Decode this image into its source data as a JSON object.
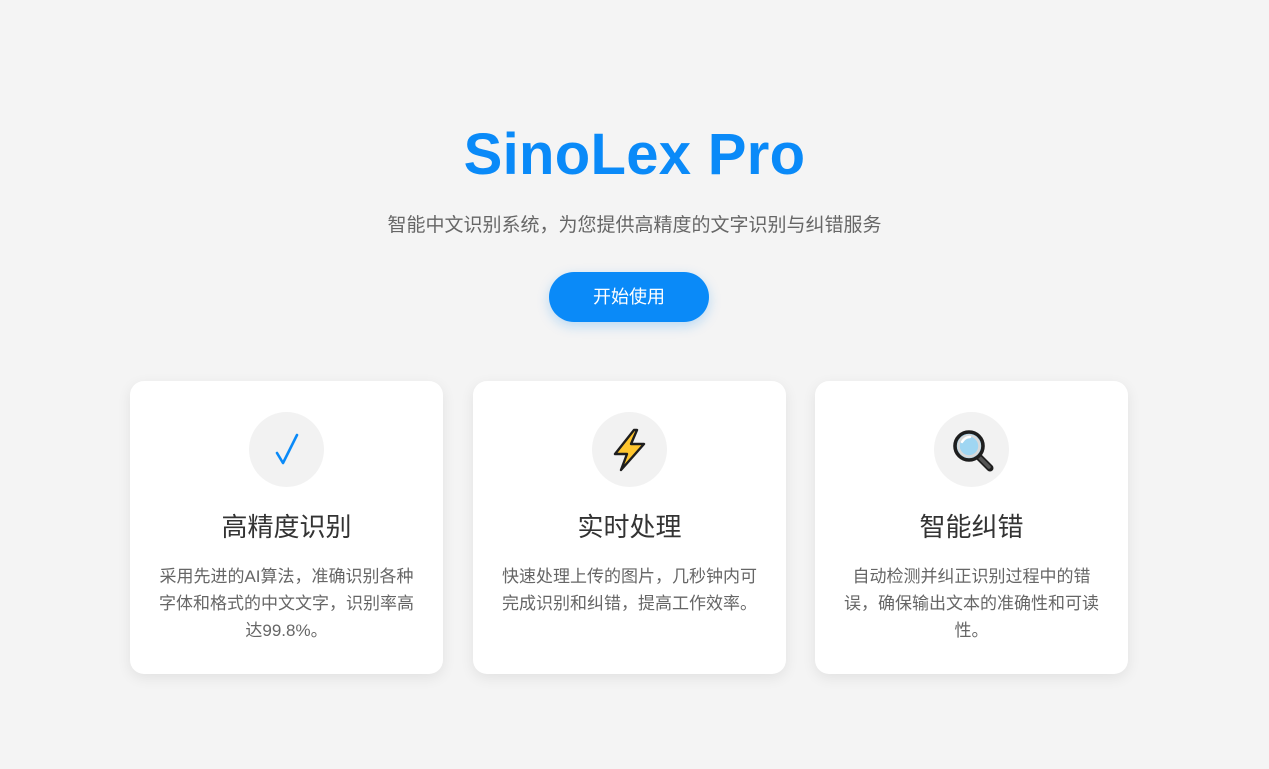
{
  "hero": {
    "title": "SinoLex Pro",
    "subtitle": "智能中文识别系统，为您提供高精度的文字识别与纠错服务",
    "cta_label": "开始使用"
  },
  "features": [
    {
      "icon": "checkmark-icon",
      "title": "高精度识别",
      "description": "采用先进的AI算法，准确识别各种字体和格式的中文文字，识别率高达99.8%。"
    },
    {
      "icon": "lightning-icon",
      "title": "实时处理",
      "description": "快速处理上传的图片，几秒钟内可完成识别和纠错，提高工作效率。"
    },
    {
      "icon": "magnifier-icon",
      "title": "智能纠错",
      "description": "自动检测并纠正识别过程中的错误，确保输出文本的准确性和可读性。"
    }
  ],
  "colors": {
    "accent": "#0a8af8",
    "background": "#f4f4f4",
    "card": "#ffffff",
    "icon_circle": "#f2f2f2",
    "text_dark": "#333333",
    "text_muted": "#666666"
  }
}
